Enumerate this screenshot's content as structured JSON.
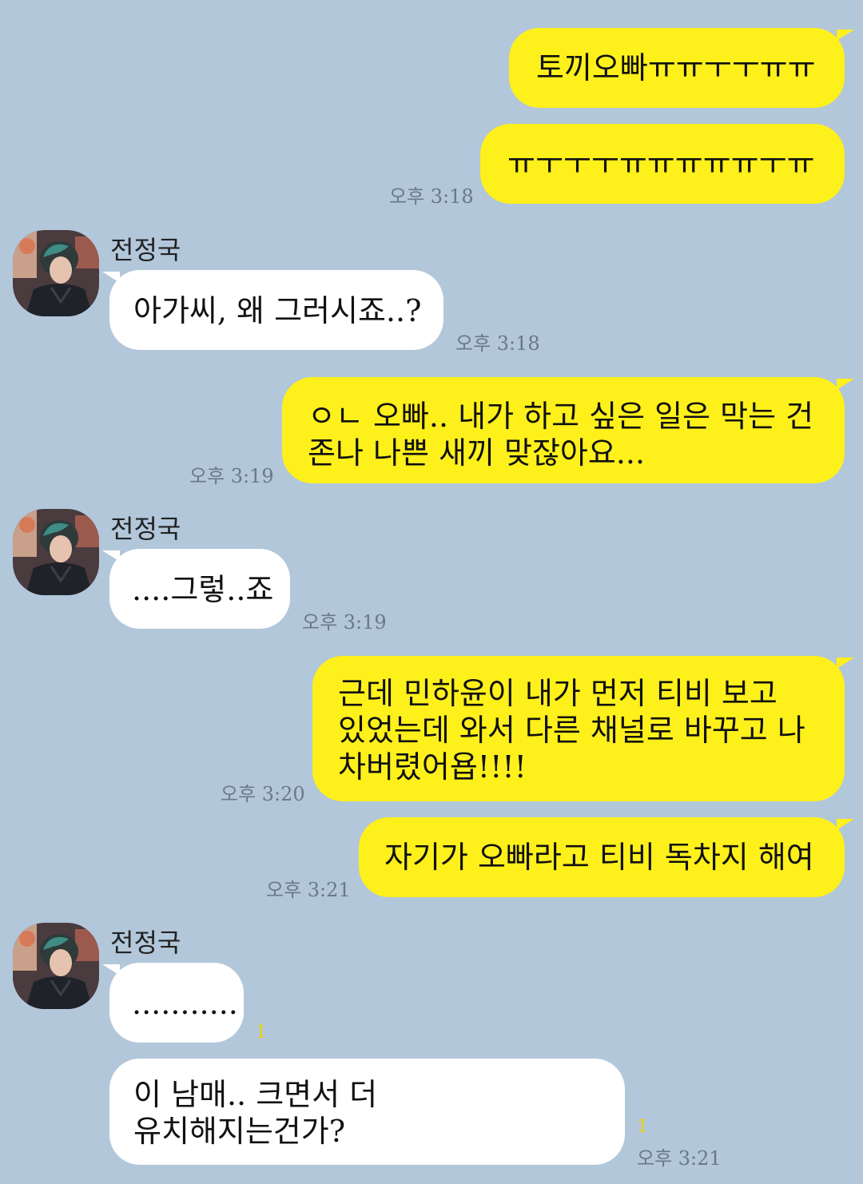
{
  "sender_name": "전정국",
  "messages": {
    "m1": "토끼오빠ㅠㅠㅜㅜㅠㅠ",
    "m2": "ㅠㅜㅜㅜㅠㅠㅠㅠㅠㅜㅠ",
    "t2": "오후 3:18",
    "r1": "아가씨, 왜 그러시죠..?",
    "rt1": "오후 3:18",
    "m3": "ㅇㄴ 오빠.. 내가 하고 싶은 일은 막는 건\n존나 나쁜 새끼 맞잖아요...",
    "t3": "오후 3:19",
    "r2": "....그렇..죠",
    "rt2": "오후 3:19",
    "m4": "근데 민하윤이 내가 먼저 티비 보고\n있었는데 와서 다른 채널로 바꾸고 나\n차버렸어욥!!!!",
    "t4": "오후 3:20",
    "m5": "자기가 오빠라고 티비 독차지 해여",
    "t5": "오후 3:21",
    "r3": "...........",
    "r3_unread": "1",
    "r4": "이 남매.. 크면서 더\n유치해지는건가?",
    "r4_unread": "1",
    "rt4": "오후 3:21"
  },
  "colors": {
    "background": "#b2c7da",
    "my_bubble": "#fef01b",
    "their_bubble": "#ffffff",
    "time_text": "#6b7888",
    "unread_count": "#f2d200"
  },
  "icons": {
    "avatar": "profile-photo"
  }
}
